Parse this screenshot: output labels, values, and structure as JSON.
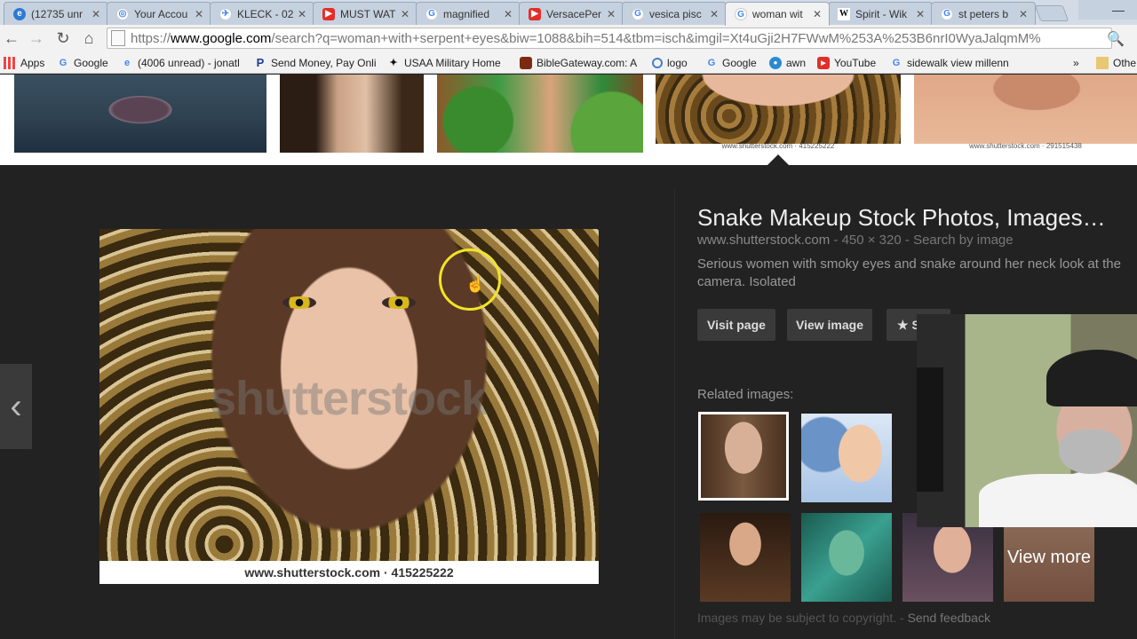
{
  "tabs": [
    {
      "title": "(12735 unr",
      "icon": "mail-icon",
      "active": false
    },
    {
      "title": "Your Accou",
      "icon": "globe-icon",
      "active": false
    },
    {
      "title": "KLECK - 02",
      "icon": "bird-icon",
      "active": false
    },
    {
      "title": "MUST WAT",
      "icon": "youtube-icon",
      "active": false
    },
    {
      "title": "magnified",
      "icon": "google-icon",
      "active": false
    },
    {
      "title": "VersacePer",
      "icon": "youtube-icon",
      "active": false
    },
    {
      "title": "vesica pisc",
      "icon": "google-icon",
      "active": false
    },
    {
      "title": "woman wit",
      "icon": "google-icon",
      "active": true
    },
    {
      "title": "Spirit - Wik",
      "icon": "wikipedia-icon",
      "active": false
    },
    {
      "title": "st peters b",
      "icon": "google-icon",
      "active": false
    }
  ],
  "omnibox": {
    "scheme": "https://",
    "domain": "www.google.com",
    "path": "/search?q=woman+with+serpent+eyes&biw=1088&bih=514&tbm=isch&imgil=Xt4uGji2H7FWwM%253A%253B6nrI0WyaJalqmM%"
  },
  "bookmarks": [
    {
      "label": "Apps",
      "icon": "apps-icon"
    },
    {
      "label": "Google",
      "icon": "google-icon"
    },
    {
      "label": "(4006 unread) - jonatl",
      "icon": "mail-icon"
    },
    {
      "label": "Send Money, Pay Onli",
      "icon": "paypal-icon"
    },
    {
      "label": "USAA Military Home",
      "icon": "usaa-icon"
    },
    {
      "label": "BibleGateway.com: A",
      "icon": "biblegateway-icon"
    },
    {
      "label": "logo",
      "icon": "circle-icon"
    },
    {
      "label": "Google",
      "icon": "google-icon"
    },
    {
      "label": "awn",
      "icon": "awn-icon"
    },
    {
      "label": "YouTube",
      "icon": "youtube-icon"
    },
    {
      "label": "sidewalk view millenn",
      "icon": "google-icon"
    }
  ],
  "bookmarks_overflow": "»",
  "other_bookmarks": "Othe",
  "strip": {
    "captions": [
      "www.shutterstock.com · 415225222",
      "www.shutterstock.com · 291515438"
    ]
  },
  "detail": {
    "title": "Snake Makeup Stock Photos, Images…",
    "site": "www.shutterstock.com",
    "dims": "450 × 320",
    "search_by_image": "Search by image",
    "description": "Serious women with smoky eyes and snake around her neck look at the camera. Isolated",
    "buttons": {
      "visit": "Visit page",
      "view": "View image",
      "save": "S"
    },
    "image_watermark": "shutterstock",
    "image_caption": "www.shutterstock.com · 415225222",
    "related_label": "Related images:",
    "view_more": "View more",
    "copyright": "Images may be subject to copyright.",
    "feedback": "Send feedback"
  },
  "colors": {
    "page_bg": "#222222",
    "cursor_ring": "#f0e428",
    "tab_active": "#f2f2f2"
  }
}
